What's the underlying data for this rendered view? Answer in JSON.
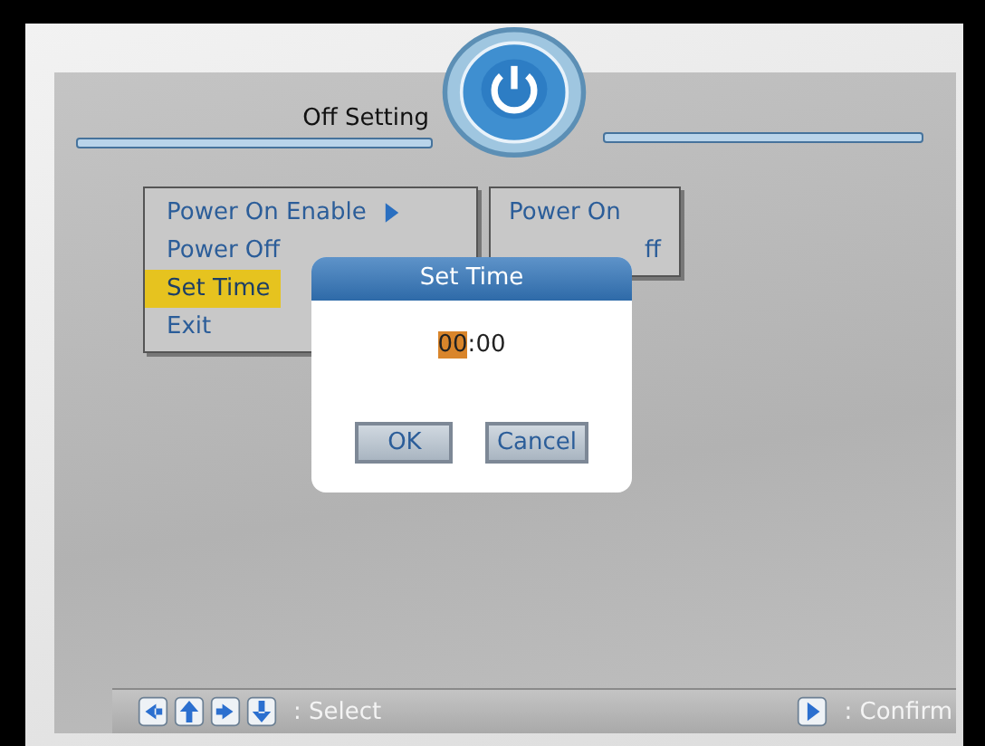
{
  "header": {
    "title": "Off Setting"
  },
  "menu": {
    "items": [
      {
        "label": "Power On Enable",
        "selected": false,
        "has_submenu": true
      },
      {
        "label": "Power Off",
        "selected": false,
        "has_submenu": false
      },
      {
        "label": "Set Time",
        "selected": true,
        "has_submenu": false
      },
      {
        "label": "Exit",
        "selected": false,
        "has_submenu": false
      }
    ]
  },
  "submenu": {
    "items": [
      {
        "label": "Power On"
      },
      {
        "label": "ff"
      }
    ]
  },
  "dialog": {
    "title": "Set Time",
    "hours": "00",
    "separator": ":",
    "minutes": "00",
    "hours_selected": true,
    "buttons": [
      {
        "label": "OK"
      },
      {
        "label": "Cancel"
      }
    ]
  },
  "footer": {
    "groups": [
      {
        "keys": [
          {
            "kind": "left"
          },
          {
            "kind": "up"
          },
          {
            "kind": "right"
          },
          {
            "kind": "down"
          }
        ],
        "text": ": Select"
      },
      {
        "keys": [
          {
            "kind": "play"
          }
        ],
        "text": ": Confirm"
      }
    ]
  }
}
